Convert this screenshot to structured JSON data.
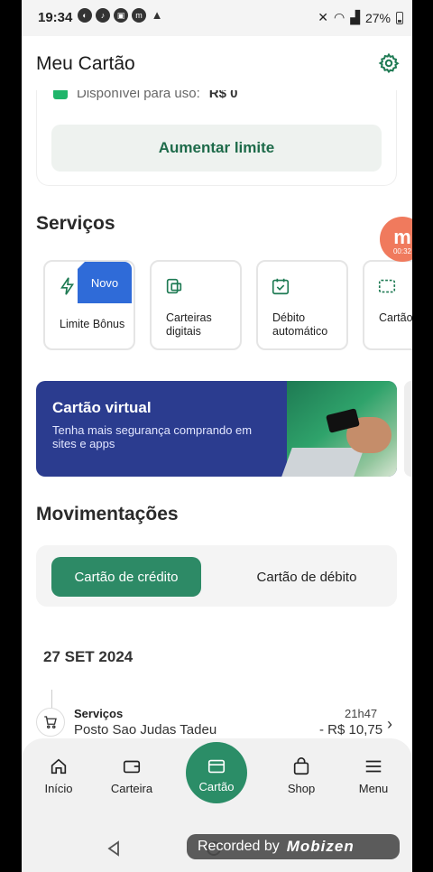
{
  "status_bar": {
    "time": "19:34",
    "battery": "27%"
  },
  "header": {
    "title": "Meu Cartão"
  },
  "card": {
    "available_label": "Disponível para uso:",
    "available_value": "R$ 0",
    "increase_limit_button": "Aumentar limite"
  },
  "services": {
    "title": "Serviços",
    "items": [
      {
        "label": "Limite Bônus",
        "badge": "Novo"
      },
      {
        "label": "Carteiras digitais"
      },
      {
        "label": "Débito automático"
      },
      {
        "label": "Cartão"
      }
    ]
  },
  "floating_bubble": {
    "timer": "00:32"
  },
  "banner": {
    "title": "Cartão virtual",
    "subtitle": "Tenha mais segurança comprando em sites e apps"
  },
  "movements": {
    "title": "Movimentações",
    "tabs": [
      "Cartão de crédito",
      "Cartão de débito"
    ],
    "date": "27 SET 2024",
    "transactions": [
      {
        "category": "Serviços",
        "name": "Posto Sao Judas Tadeu",
        "time": "21h47",
        "amount": "- R$ 10,75"
      }
    ]
  },
  "bottom_nav": {
    "items": [
      "Início",
      "Carteira",
      "Cartão",
      "Shop",
      "Menu"
    ]
  },
  "recorder": {
    "label": "Recorded by",
    "brand": "Mobizen"
  },
  "colors": {
    "primary_green": "#2b8d67",
    "banner_blue": "#2b3c8f",
    "badge_blue": "#2f6bd8"
  }
}
